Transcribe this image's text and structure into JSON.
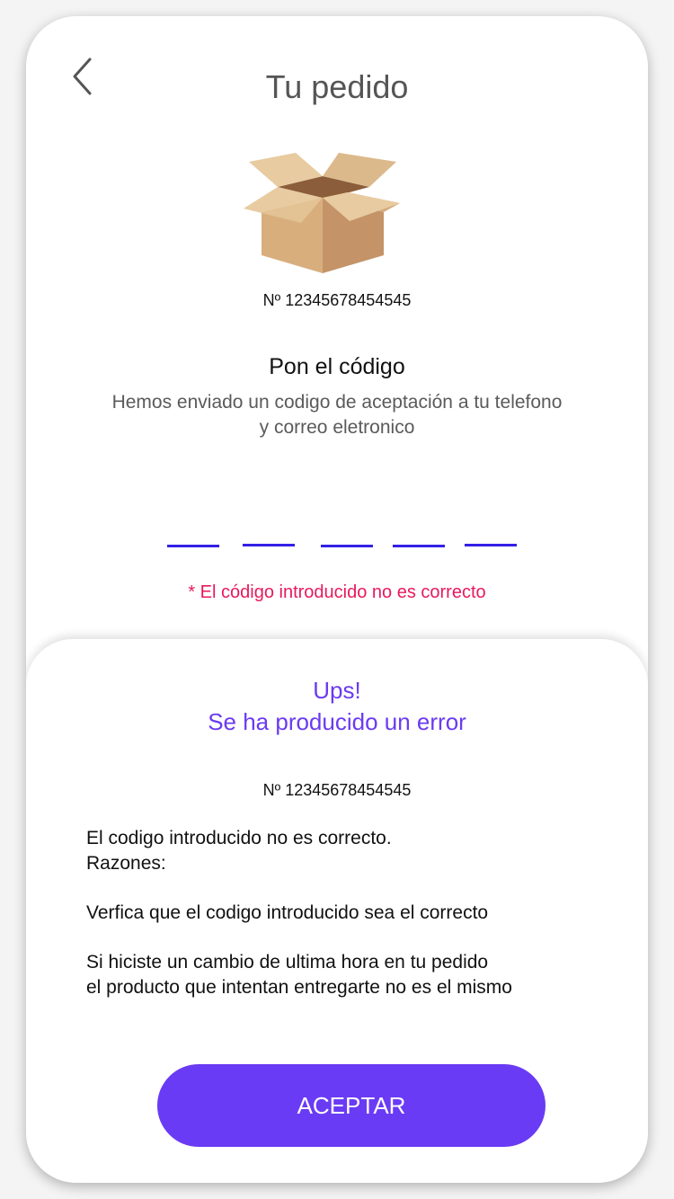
{
  "header": {
    "title": "Tu pedido",
    "back_icon": "chevron-left-icon"
  },
  "order": {
    "number_label": "Nº 12345678454545"
  },
  "code_entry": {
    "title": "Pon el código",
    "description_line1": "Hemos enviado un codigo de aceptación a tu telefono",
    "description_line2": "y correo eletronico",
    "slots": [
      "",
      "",
      "",
      "",
      ""
    ],
    "error": "* El código introducido no es correcto"
  },
  "error_sheet": {
    "title_line1": "Ups!",
    "title_line2": "Se ha producido un error",
    "order_number": "Nº 12345678454545",
    "body": {
      "line1": "El codigo introducido no es correcto.",
      "line2": "Razones:",
      "line3": "Verfica que el codigo introducido sea el correcto",
      "line4": "Si hiciste un cambio de ultima hora en tu pedido",
      "line5": "el producto que intentan entregarte no es el mismo"
    },
    "accept_label": "ACEPTAR"
  },
  "colors": {
    "accent": "#6a3bf5",
    "error": "#e8195c",
    "code_underline": "#3320e6",
    "box_light": "#e8cba0",
    "box_dark": "#c49468"
  }
}
